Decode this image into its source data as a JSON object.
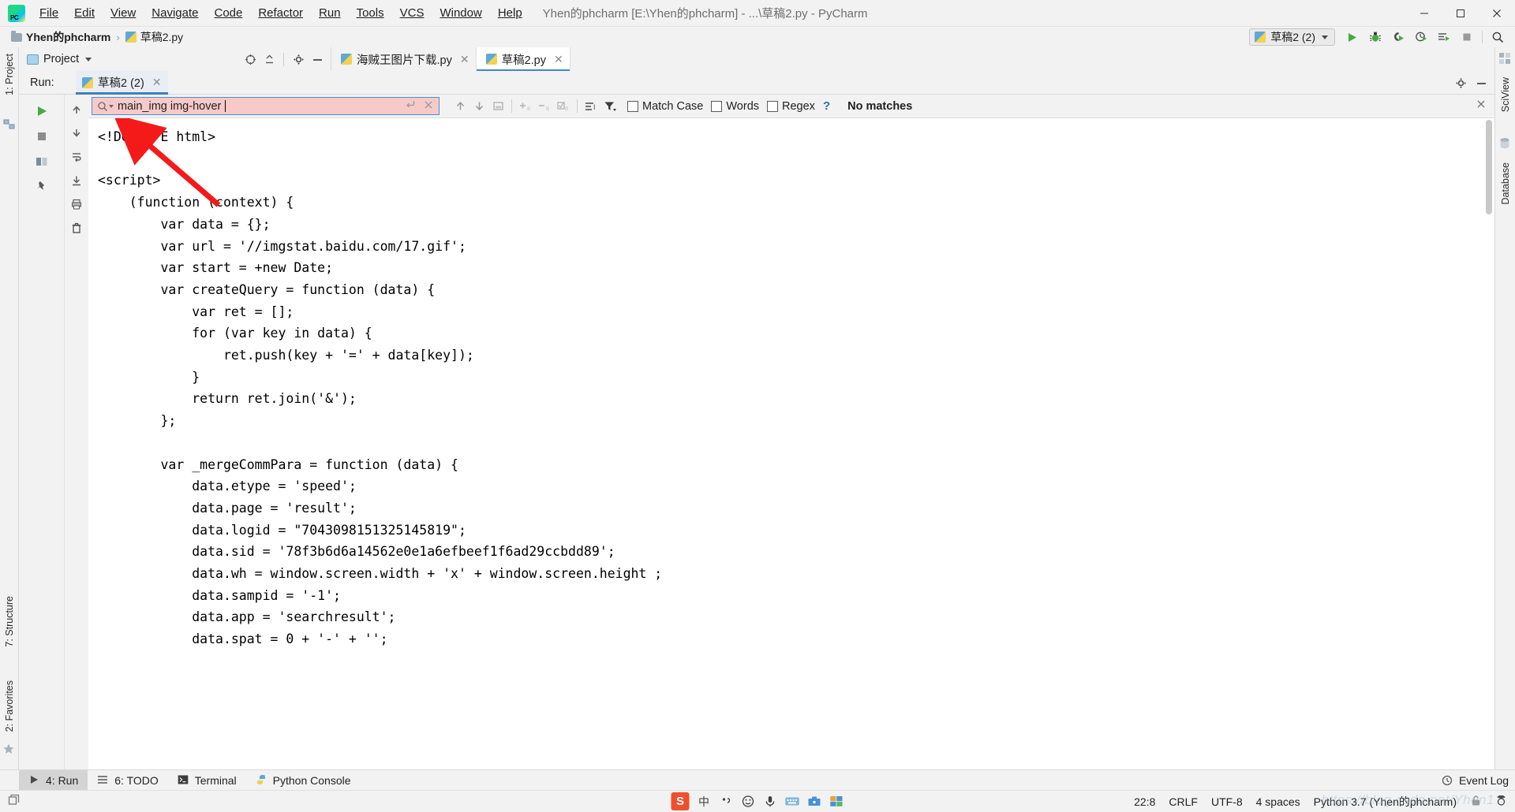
{
  "titlebar": {
    "logo_name": "pycharm-logo",
    "menus": [
      "File",
      "Edit",
      "View",
      "Navigate",
      "Code",
      "Refactor",
      "Run",
      "Tools",
      "VCS",
      "Window",
      "Help"
    ],
    "window_title": "Yhen的phcharm [E:\\Yhen的phcharm] - ...\\草稿2.py - PyCharm",
    "minimize": "–",
    "maximize": "☐",
    "close": "✕"
  },
  "navbar": {
    "project_crumb": "Yhen的phcharm",
    "file_crumb": "草稿2.py",
    "separator": "›",
    "run_config": "草稿2 (2)",
    "toolbar_buttons": [
      "run-button",
      "debug-button",
      "coverage-button",
      "profile-button",
      "run-with-console-button",
      "stop-button",
      "search-everywhere-button"
    ]
  },
  "left_strip": {
    "project_tab": "1: Project",
    "structure_tab": "7: Structure",
    "favorites_tab": "2: Favorites"
  },
  "right_strip": {
    "sciview_tab": "SciView",
    "database_tab": "Database"
  },
  "project_panel": {
    "title": "Project",
    "actions": [
      "locate-icon",
      "collapse-all-icon",
      "settings-icon",
      "hide-icon"
    ]
  },
  "editor_tabs": [
    {
      "label": "海贼王图片下载.py",
      "active": false,
      "close": "✕"
    },
    {
      "label": "草稿2.py",
      "active": true,
      "close": "✕"
    }
  ],
  "run_window": {
    "label": "Run:",
    "tab": "草稿2 (2)",
    "tab_close": "✕",
    "header_actions": [
      "settings-icon",
      "hide-icon"
    ]
  },
  "search": {
    "value": "main_img img-hover",
    "placeholder": "Search",
    "status": "No matches",
    "help": "?",
    "options": [
      {
        "label": "Match Case",
        "checked": false
      },
      {
        "label": "Words",
        "checked": false
      },
      {
        "label": "Regex",
        "checked": false
      }
    ],
    "buttons": [
      "prev-match-button",
      "next-match-button",
      "select-all-button",
      "add-line-button",
      "remove-line-button",
      "toggle-lines-button",
      "filter-lines-button",
      "filter-icon",
      "close-search-button"
    ]
  },
  "console": {
    "code": "<!DOCTYPE html>\n\n<script>\n    (function (context) {\n        var data = {};\n        var url = '//imgstat.baidu.com/17.gif';\n        var start = +new Date;\n        var createQuery = function (data) {\n            var ret = [];\n            for (var key in data) {\n                ret.push(key + '=' + data[key]);\n            }\n            return ret.join('&');\n        };\n\n        var _mergeCommPara = function (data) {\n            data.etype = 'speed';\n            data.page = 'result';\n            data.logid = \"7043098151325145819\";\n            data.sid = '78f3b6d6a14562e0e1a6efbeef1f6ad29ccbdd89';\n            data.wh = window.screen.width + 'x' + window.screen.height ;\n            data.sampid = '-1';\n            data.app = 'searchresult';\n            data.spat = 0 + '-' + '';"
  },
  "bottom_bar": {
    "items": [
      {
        "label": "4: Run",
        "icon": "run-icon",
        "selected": true
      },
      {
        "label": "6: TODO",
        "icon": "todo-icon",
        "selected": false
      },
      {
        "label": "Terminal",
        "icon": "terminal-icon",
        "selected": false
      },
      {
        "label": "Python Console",
        "icon": "python-icon",
        "selected": false
      }
    ],
    "event_log": "Event Log"
  },
  "statusbar": {
    "caret": "22:8",
    "line_sep": "CRLF",
    "encoding": "UTF-8",
    "indent": "4 spaces",
    "interpreter": "Python 3.7 (Yhen的phcharm)",
    "tray": [
      "sogou-icon",
      "chinese-mode",
      "punctuation-icon",
      "emoji-icon",
      "mic-icon",
      "keyboard-icon",
      "toolbox-icon",
      "panel-icon"
    ],
    "ime_mode": "中",
    "watermark": "https://blog.csdn.net/Yhen1"
  },
  "colors": {
    "accent": "#3f7fc1",
    "search_error_bg": "#f7c9c9",
    "arrow": "#f41a1a",
    "chrome_bg": "#f2f2f2",
    "editor_bg": "#ffffff"
  }
}
